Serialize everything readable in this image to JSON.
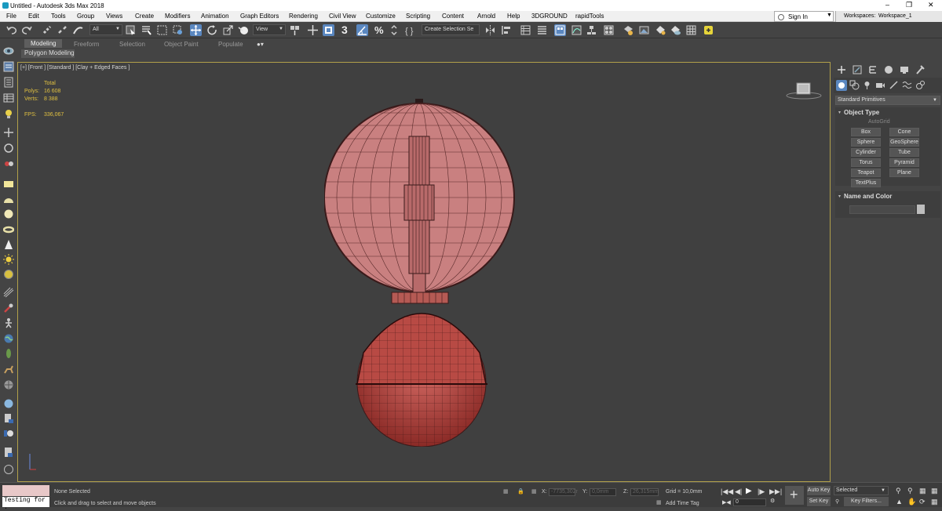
{
  "window": {
    "title": "Untitled - Autodesk 3ds Max 2018"
  },
  "menu": {
    "items": [
      "File",
      "Edit",
      "Tools",
      "Group",
      "Views",
      "Create",
      "Modifiers",
      "Animation",
      "Graph Editors",
      "Rendering",
      "Civil View",
      "Customize",
      "Scripting",
      "Content",
      "Arnold",
      "Help",
      "3DGROUND",
      "rapidTools"
    ],
    "sign_in": "Sign In",
    "workspaces_label": "Workspaces:",
    "workspace_value": "Workspace_1"
  },
  "toolbar": {
    "filter_value": "All",
    "refcoord_value": "View",
    "selection_set_placeholder": "Create Selection Se",
    "snap_number": "3"
  },
  "ribbon": {
    "tabs": [
      "Modeling",
      "Freeform",
      "Selection",
      "Object Paint",
      "Populate"
    ],
    "active_tab": "Modeling",
    "sub_label": "Polygon Modeling"
  },
  "viewport": {
    "label": "[+] [Front ] [Standard ] [Clay + Edged Faces ]",
    "stats": {
      "total_label": "Total",
      "polys_label": "Polys:",
      "polys_value": "16 608",
      "verts_label": "Verts:",
      "verts_value": "8 388",
      "fps_label": "FPS:",
      "fps_value": "336,067"
    },
    "model_color": "#b84a44",
    "glass_color": "#c98080"
  },
  "command_panel": {
    "dropdown": "Standard Primitives",
    "object_type_title": "Object Type",
    "autogrid": "AutoGrid",
    "buttons": [
      "Box",
      "Cone",
      "Sphere",
      "GeoSphere",
      "Cylinder",
      "Tube",
      "Torus",
      "Pyramid",
      "Teapot",
      "Plane",
      "TextPlus"
    ],
    "name_color_title": "Name and Color"
  },
  "status": {
    "script_text": "Testing for .",
    "selection_status": "None Selected",
    "prompt": "Click and drag to select and move objects",
    "x_label": "X:",
    "x_value": "-7735,302r",
    "y_label": "Y:",
    "y_value": "0,0mm",
    "z_label": "Z:",
    "z_value": "26,315mm",
    "grid": "Grid = 10,0mm",
    "add_time_tag": "Add Time Tag",
    "frame_value": "0",
    "auto_key": "Auto Key",
    "set_key": "Set Key",
    "selected_dropdown": "Selected",
    "key_filters": "Key Filters..."
  }
}
